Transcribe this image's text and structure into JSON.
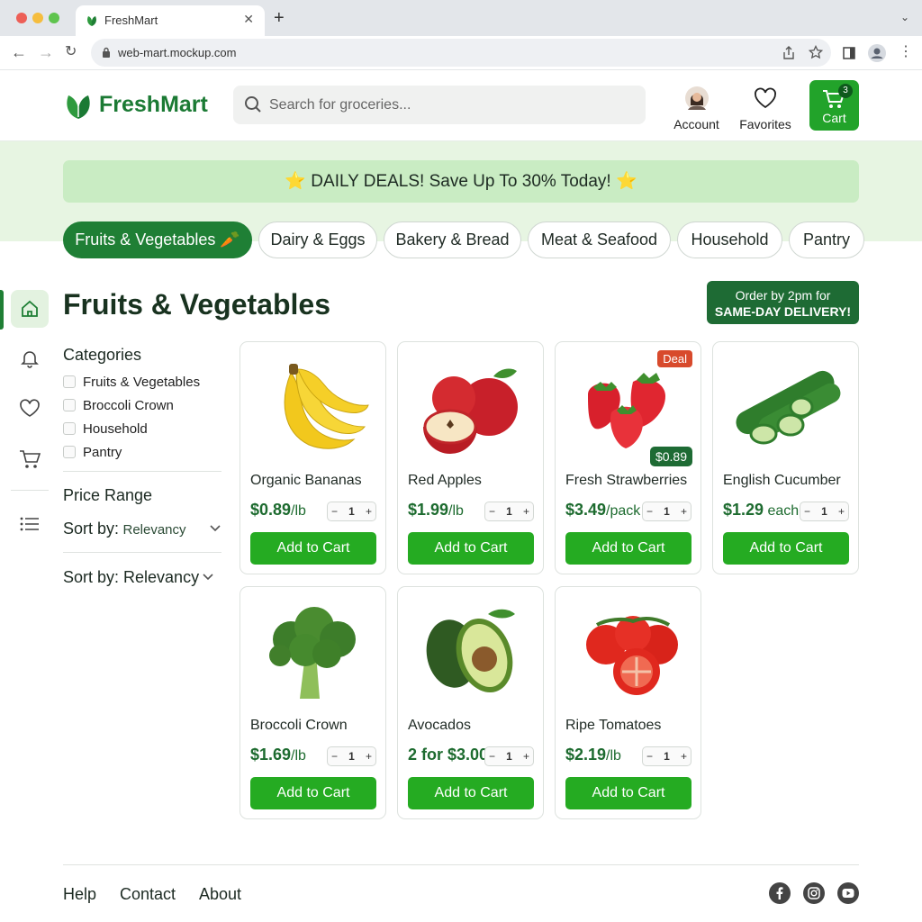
{
  "browser": {
    "tab_title": "FreshMart",
    "url": "web-mart.mockup.com"
  },
  "header": {
    "brand": "FreshMart",
    "search_placeholder": "Search for groceries...",
    "account_label": "Account",
    "favorites_label": "Favorites",
    "cart_label": "Cart",
    "cart_count": "3"
  },
  "banner": {
    "text": "⭐ DAILY DEALS! Save Up To 30% Today! ⭐"
  },
  "category_tabs": [
    {
      "label": "Fruits & Vegetables 🥕",
      "active": true
    },
    {
      "label": "Dairy & Eggs"
    },
    {
      "label": "Bakery & Bread"
    },
    {
      "label": "Meat & Seafood"
    },
    {
      "label": "Household"
    },
    {
      "label": "Pantry"
    }
  ],
  "page": {
    "title": "Fruits & Vegetables",
    "delivery_line1": "Order by 2pm for",
    "delivery_line2": "SAME-DAY DELIVERY!"
  },
  "filters": {
    "categories_heading": "Categories",
    "categories": [
      "Fruits & Vegetables",
      "Broccoli Crown",
      "Household",
      "Pantry"
    ],
    "price_heading": "Price Range",
    "sort1_label": "Sort by:",
    "sort1_value": "Relevancy",
    "sort2_label": "Sort by: Relevancy"
  },
  "products": [
    {
      "name": "Organic Bananas",
      "price": "$0.89",
      "unit": "/lb",
      "qty": "1",
      "button": "Add to Cart"
    },
    {
      "name": "Red Apples",
      "price": "$1.99",
      "unit": "/lb",
      "qty": "1",
      "button": "Add to Cart"
    },
    {
      "name": "Fresh Strawberries",
      "price": "$3.49",
      "unit": "/pack",
      "qty": "1",
      "button": "Add to Cart",
      "deal_tag": "Deal",
      "sale_price": "$0.89"
    },
    {
      "name": "English Cucumber",
      "price": "$1.29",
      "unit": " each",
      "qty": "1",
      "button": "Add to Cart"
    },
    {
      "name": "Broccoli Crown",
      "price": "$1.69",
      "unit": "/lb",
      "qty": "1",
      "button": "Add to Cart"
    },
    {
      "name": "Avocados",
      "price": "2 for $3.00",
      "unit": "",
      "qty": "1",
      "button": "Add to Cart"
    },
    {
      "name": "Ripe Tomatoes",
      "price": "$2.19",
      "unit": "/lb",
      "qty": "1",
      "button": "Add to Cart"
    }
  ],
  "footer": {
    "links": [
      "Help",
      "Contact",
      "About"
    ]
  },
  "colors": {
    "brand_green": "#1f7f35",
    "button_green": "#25ab22",
    "deal_red": "#d84a2c",
    "banner_bg": "#c9ecc3"
  }
}
